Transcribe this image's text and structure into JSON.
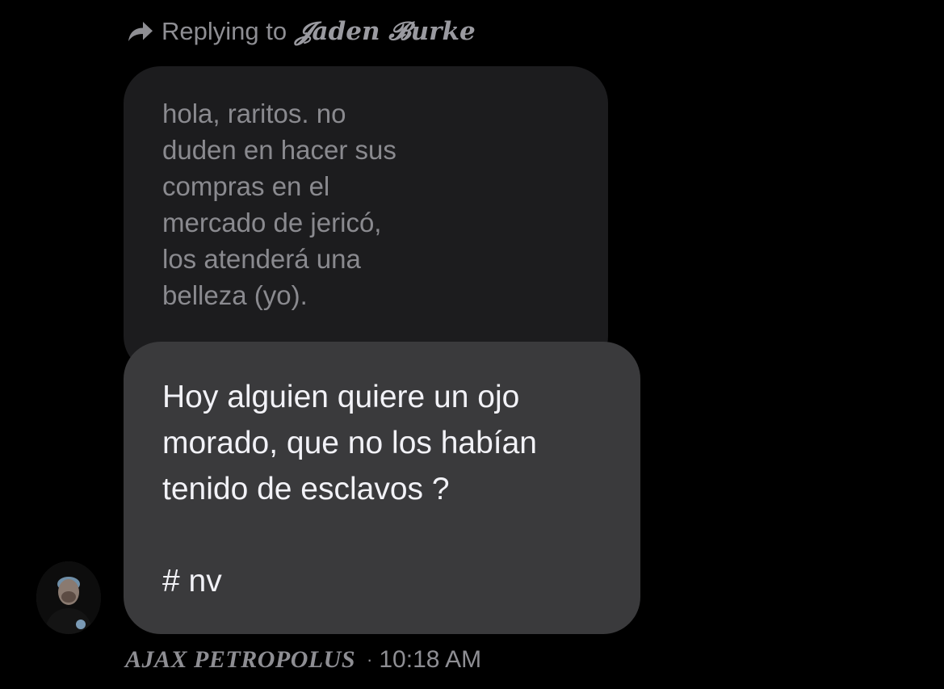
{
  "reply_header": {
    "prefix": "Replying to",
    "name": "𝓙aden 𝓑urke",
    "icon": "reply-arrow-icon"
  },
  "quoted_message": {
    "text": "hola, raritos. no\nduden en hacer sus\ncompras en el\nmercado de jericó,\nlos atenderá una\nbelleza (yo)."
  },
  "message": {
    "text": "Hoy alguien quiere un ojo\nmorado, que no los habían\ntenido de esclavos ?\n\n# nv"
  },
  "sender": {
    "name": "AJAX PETROPOLUS",
    "separator": "·",
    "time": "10:18 AM",
    "avatar_icon": "user-avatar"
  },
  "colors": {
    "background": "#000000",
    "quoted_bubble": "#1c1c1e",
    "message_bubble": "#3a3a3c",
    "primary_text": "#f2f2f7",
    "secondary_text": "#8e8e93"
  }
}
